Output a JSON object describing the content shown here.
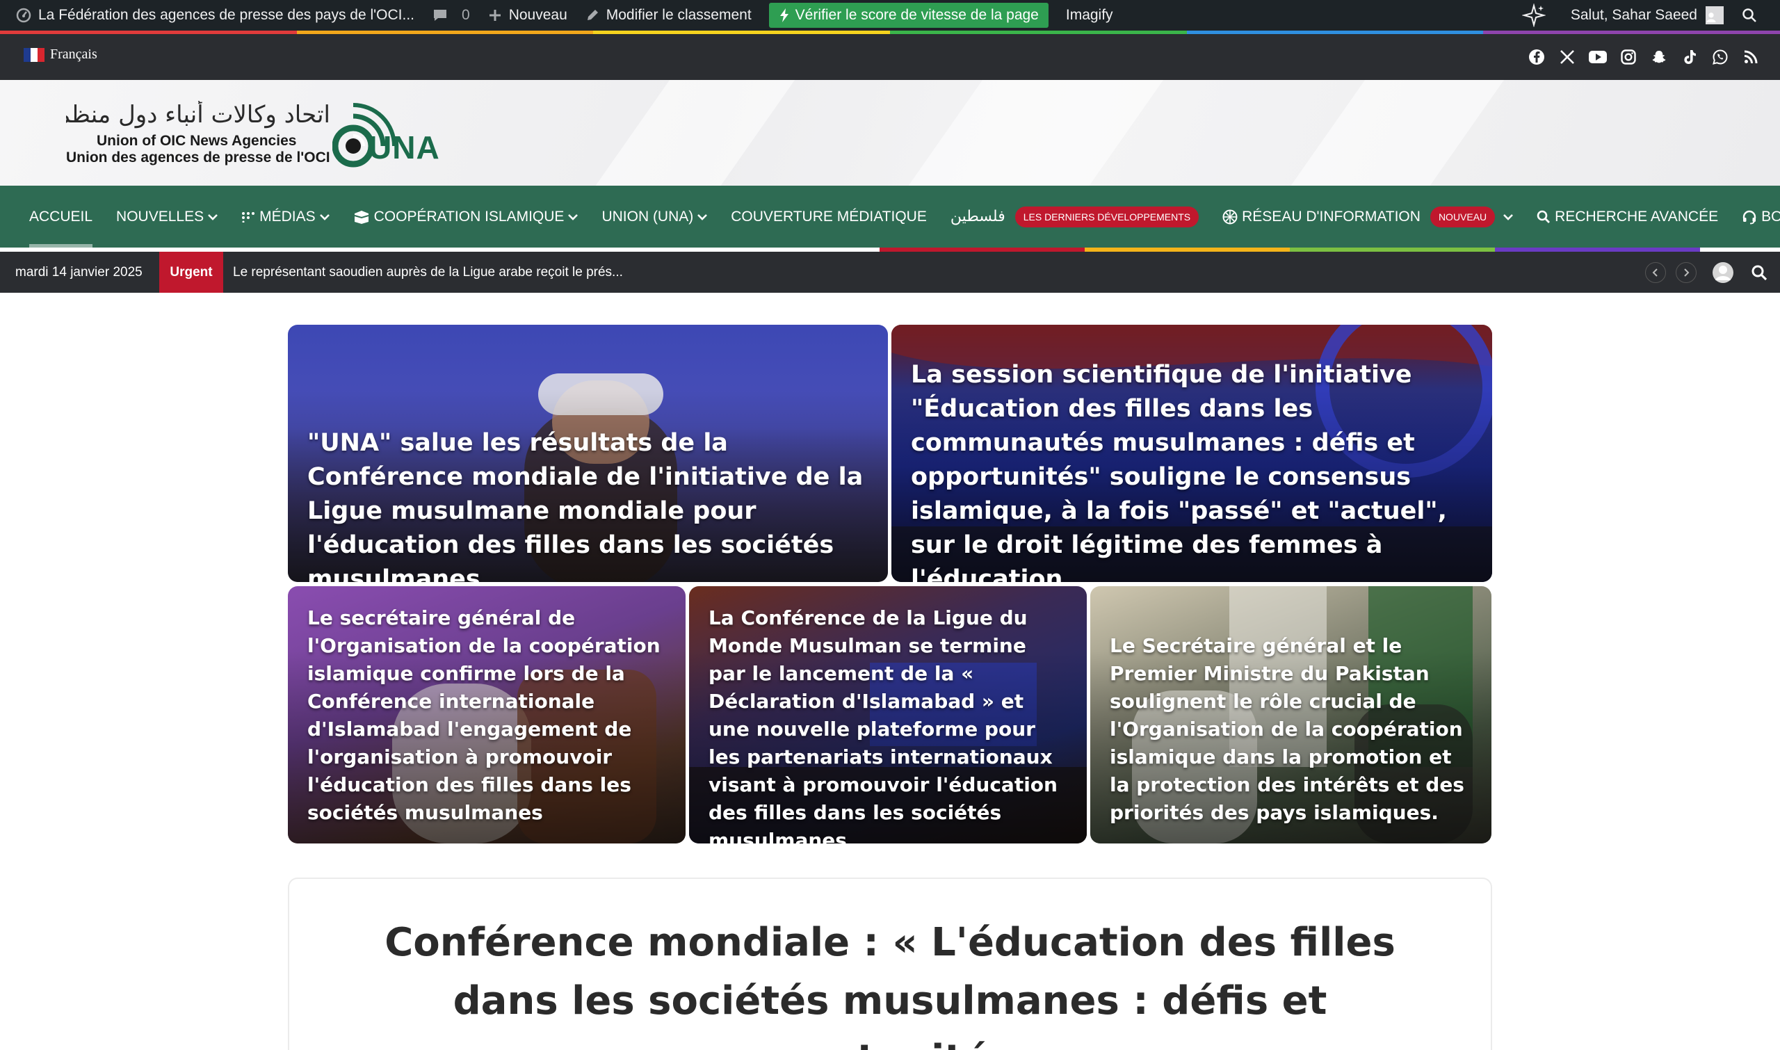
{
  "adminbar": {
    "site_name": "La Fédération des agences de presse des pays de l'OCI...",
    "comments_count": "0",
    "new_label": "Nouveau",
    "edit_label": "Modifier le classement",
    "speed_label": "Vérifier le score de vitesse de la page",
    "imagify_label": "Imagify",
    "greeting": "Salut, Sahar Saeed"
  },
  "topbar": {
    "language": "Français",
    "social_icons": [
      "facebook-icon",
      "x-icon",
      "youtube-icon",
      "instagram-icon",
      "snapchat-icon",
      "tiktok-icon",
      "whatsapp-icon",
      "rss-icon"
    ]
  },
  "logo": {
    "arabic": "اتحاد وكالات أنباء دول منظمة التعاون الإسلامي",
    "english": "Union of OIC News Agencies",
    "french": "Union des agences de presse de l'OCI",
    "mark": "UNA"
  },
  "nav": {
    "items": [
      {
        "label": "ACCUEIL"
      },
      {
        "label": "NOUVELLES"
      },
      {
        "label": "MÉDIAS"
      },
      {
        "label": "COOPÉRATION ISLAMIQUE"
      },
      {
        "label": "UNION (UNA)"
      },
      {
        "label": "COUVERTURE MÉDIATIQUE"
      },
      {
        "label": "فلسطين",
        "badge": "LES DERNIERS DÉVELOPPEMENTS"
      },
      {
        "label": "RÉSEAU D'INFORMATION",
        "badge": "NOUVEAU"
      },
      {
        "label": "RECHERCHE AVANCÉE"
      },
      {
        "label": "BOT IA"
      }
    ]
  },
  "breaking": {
    "date": "mardi 14 janvier 2025",
    "label": "Urgent",
    "headline": "Le représentant saoudien auprès de la Ligue arabe reçoit le prés..."
  },
  "featured": [
    {
      "title": "\"UNA\" salue les résultats de la Conférence mondiale de l'initiative de la Ligue musulmane mondiale pour l'éducation des filles dans les sociétés musulmanes"
    },
    {
      "title": "La session scientifique de l'initiative \"Éducation des filles dans les communautés musulmanes : défis et opportunités\" souligne le consensus islamique, à la fois \"passé\" et \"actuel\", sur le droit légitime des femmes à l'éducation"
    },
    {
      "title": "Le secrétaire général de l'Organisation de la coopération islamique confirme lors de la Conférence internationale d'Islamabad l'engagement de l'organisation à promouvoir l'éducation des filles dans les sociétés musulmanes"
    },
    {
      "title": "La Conférence de la Ligue du Monde Musulman se termine par le lancement de la « Déclaration d'Islamabad » et une nouvelle plateforme pour les partenariats internationaux visant à promouvoir l'éducation des filles dans les sociétés musulmanes"
    },
    {
      "title": "Le Secrétaire général et le Premier Ministre du Pakistan soulignent le rôle crucial de l'Organisation de la coopération islamique dans la promotion et la protection des intérêts et des priorités des pays islamiques."
    }
  ],
  "section": {
    "title": "Conférence mondiale : « L'éducation des filles dans les sociétés musulmanes : défis et opportunités »"
  },
  "colors": {
    "nav_green": "#2e6b53",
    "dark_bar": "#2b2d31",
    "urgent_red": "#c0182d",
    "speed_green": "#2e9e52"
  }
}
